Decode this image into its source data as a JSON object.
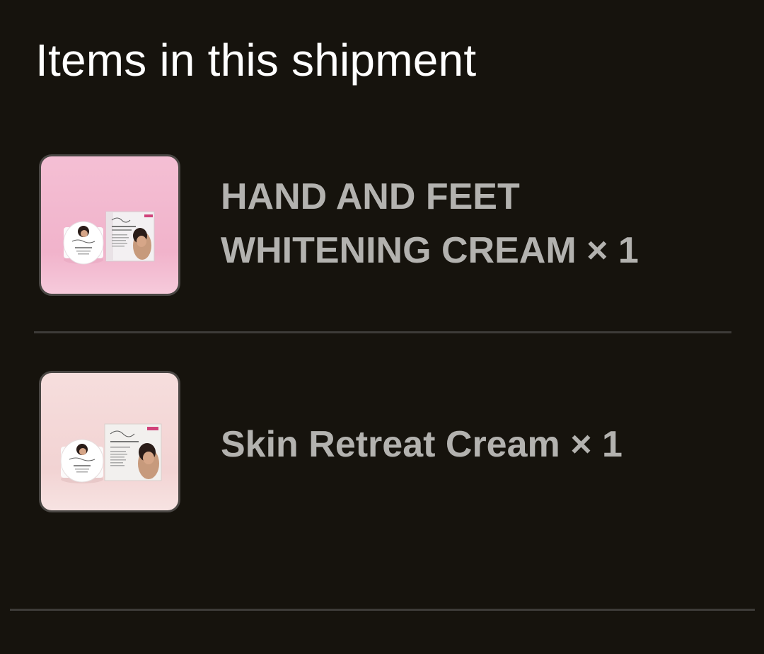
{
  "header": {
    "title": "Items in this shipment"
  },
  "items": [
    {
      "name_line1": "HAND AND FEET",
      "name_line2": "WHITENING CREAM × 1",
      "thumbnail_bg": "#f4c2d6"
    },
    {
      "name": "Skin Retreat Cream × 1",
      "thumbnail_bg": "#f3dcdc"
    }
  ],
  "colors": {
    "background": "#16130d",
    "title": "#ffffff",
    "item_text": "#b3b2af",
    "divider": "#3d3b38"
  }
}
